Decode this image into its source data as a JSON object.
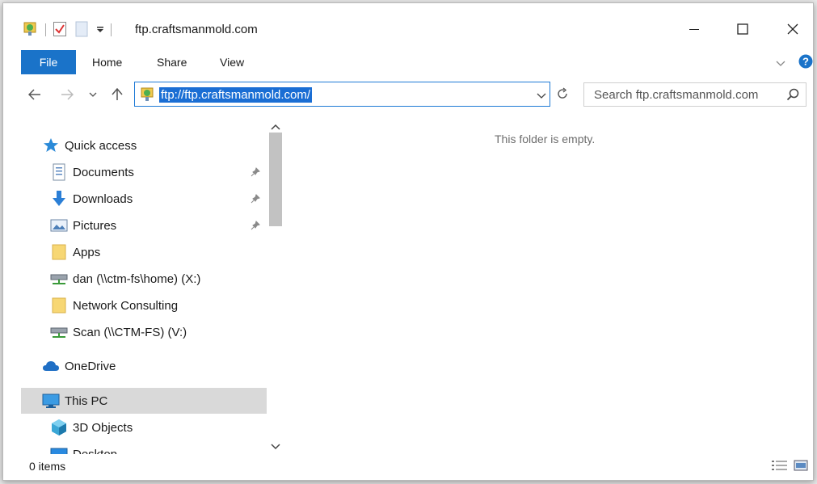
{
  "window": {
    "title": "ftp.craftsmanmold.com",
    "quick_access_toolbar": [
      "properties-icon",
      "checkmark-icon",
      "new-folder-icon",
      "customize-dropdown-icon"
    ],
    "controls": [
      "minimize-icon",
      "maximize-icon",
      "close-icon"
    ]
  },
  "ribbon": {
    "tabs": [
      "File",
      "Home",
      "Share",
      "View"
    ],
    "file_color": "#1a73c9"
  },
  "address_bar": {
    "url": "ftp://ftp.craftsmanmold.com/",
    "search_placeholder": "Search ftp.craftsmanmold.com"
  },
  "navigation_pane": {
    "items": [
      {
        "label": "Quick access",
        "icon": "star-icon",
        "pinned": false
      },
      {
        "label": "Documents",
        "icon": "documents-icon",
        "pinned": true
      },
      {
        "label": "Downloads",
        "icon": "downloads-icon",
        "pinned": true
      },
      {
        "label": "Pictures",
        "icon": "pictures-icon",
        "pinned": true
      },
      {
        "label": "Apps",
        "icon": "folder-icon",
        "pinned": false
      },
      {
        "label": "dan (\\\\ctm-fs\\home) (X:)",
        "icon": "network-drive-icon",
        "pinned": false
      },
      {
        "label": "Network Consulting",
        "icon": "folder-icon",
        "pinned": false
      },
      {
        "label": "Scan (\\\\CTM-FS) (V:)",
        "icon": "network-drive-icon",
        "pinned": false
      },
      {
        "label": "OneDrive",
        "icon": "cloud-icon",
        "pinned": false
      },
      {
        "label": "This PC",
        "icon": "computer-icon",
        "pinned": false,
        "selected": true
      },
      {
        "label": "3D Objects",
        "icon": "cube-icon",
        "pinned": false
      },
      {
        "label": "Desktop",
        "icon": "desktop-icon",
        "pinned": false
      }
    ]
  },
  "content": {
    "empty_message": "This folder is empty."
  },
  "status_bar": {
    "item_count": "0 items"
  }
}
